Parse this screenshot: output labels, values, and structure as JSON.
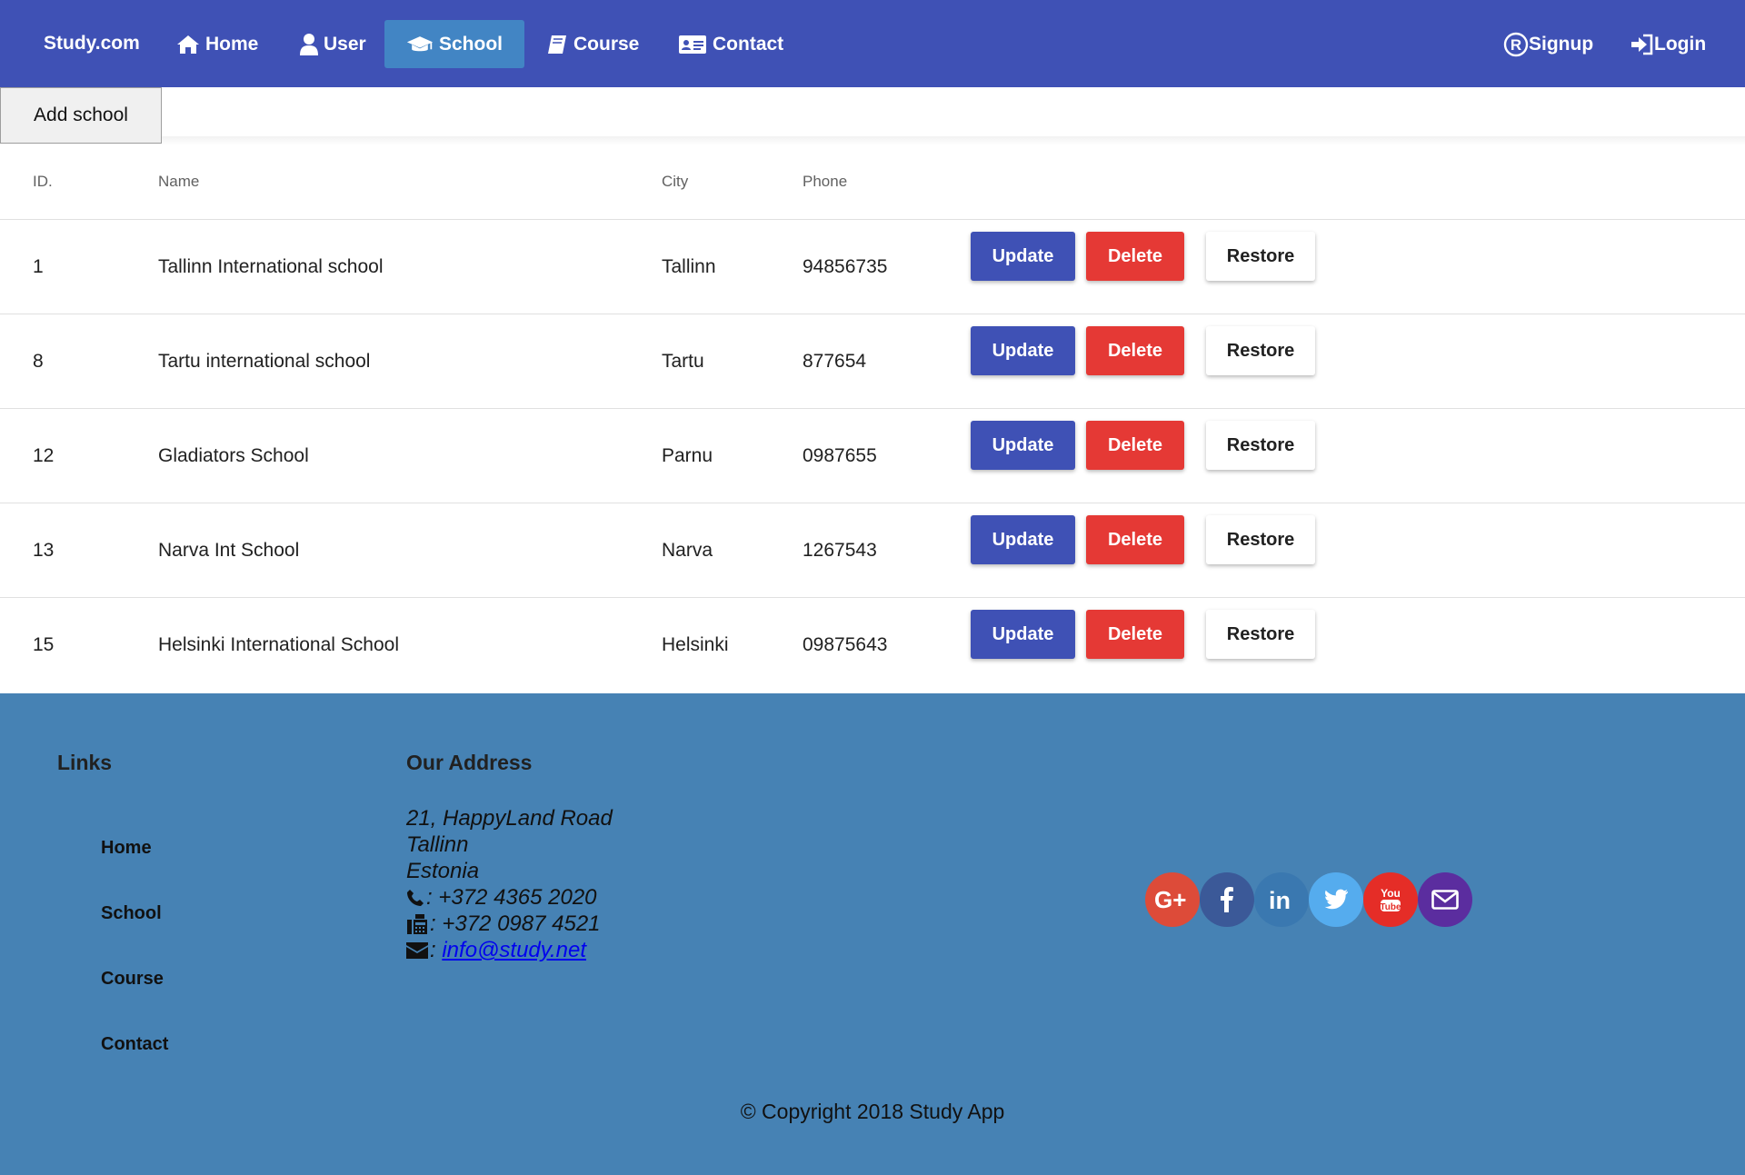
{
  "nav": {
    "brand": "Study.com",
    "items": [
      {
        "label": "Home",
        "icon": "home-icon"
      },
      {
        "label": "User",
        "icon": "user-icon"
      },
      {
        "label": "School",
        "icon": "graduation-cap-icon",
        "active": true
      },
      {
        "label": "Course",
        "icon": "book-icon"
      },
      {
        "label": "Contact",
        "icon": "address-card-icon"
      }
    ],
    "signup": "Signup",
    "login": "Login",
    "color": "#3f51b5",
    "active_color": "#4285c4"
  },
  "toolbar": {
    "add_label": "Add school"
  },
  "table": {
    "headers": [
      "ID.",
      "Name",
      "City",
      "Phone"
    ],
    "rows": [
      {
        "id": "1",
        "name": "Tallinn International school",
        "city": "Tallinn",
        "phone": "94856735"
      },
      {
        "id": "8",
        "name": "Tartu international school",
        "city": "Tartu",
        "phone": "877654"
      },
      {
        "id": "12",
        "name": "Gladiators School",
        "city": "Parnu",
        "phone": "0987655"
      },
      {
        "id": "13",
        "name": "Narva Int School",
        "city": "Narva",
        "phone": "1267543"
      },
      {
        "id": "15",
        "name": "Helsinki International School",
        "city": "Helsinki",
        "phone": "09875643"
      }
    ],
    "actions": {
      "update": "Update",
      "delete": "Delete",
      "restore": "Restore"
    }
  },
  "footer": {
    "links_heading": "Links",
    "links": [
      "Home",
      "School",
      "Course",
      "Contact"
    ],
    "address_heading": "Our Address",
    "address": {
      "street": "21, HappyLand Road",
      "city": "Tallinn",
      "country": "Estonia",
      "phone": ": +372 4365 2020",
      "fax": ": +372 0987 4521",
      "email_prefix": ": ",
      "email": "info@study.net"
    },
    "social": [
      {
        "icon": "google-plus-icon",
        "color": "#dd4b39"
      },
      {
        "icon": "facebook-icon",
        "color": "#3b5998"
      },
      {
        "icon": "linkedin-icon",
        "color": "#0e76a8"
      },
      {
        "icon": "twitter-icon",
        "color": "#55acee"
      },
      {
        "icon": "youtube-icon",
        "color": "#e52d27"
      },
      {
        "icon": "mail-icon",
        "color": "#5b2d9f"
      }
    ],
    "copyright": "© Copyright 2018 Study App",
    "background": "#4682b4"
  }
}
